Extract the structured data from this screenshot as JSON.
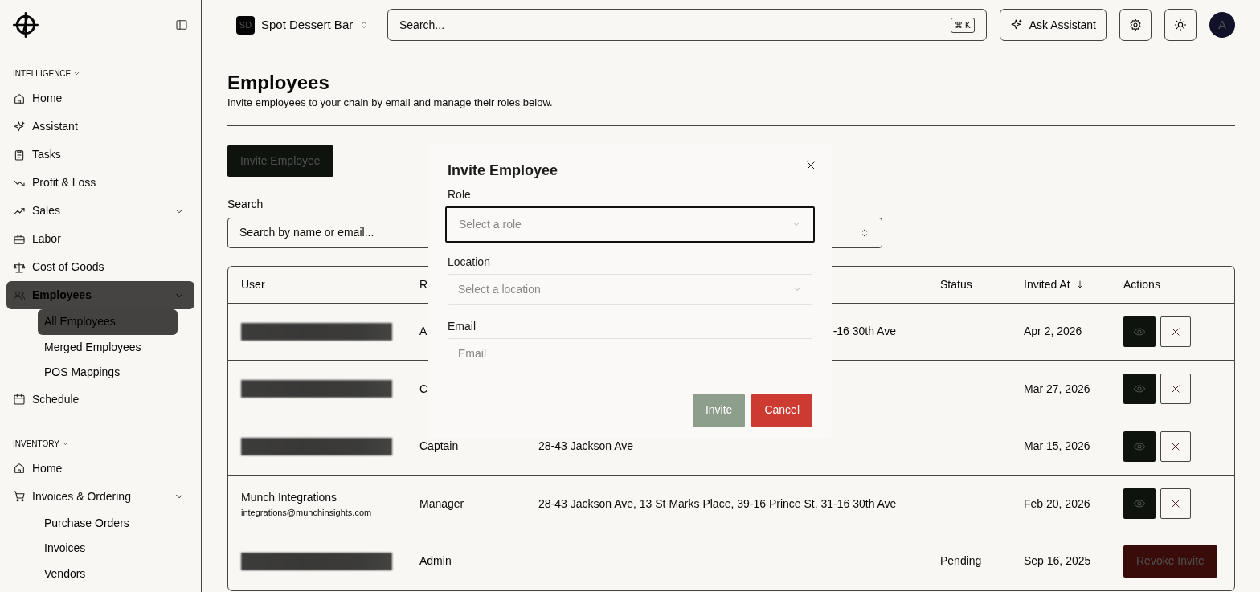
{
  "topbar": {
    "org_badge": "SD",
    "org_name": "Spot Dessert Bar",
    "search": {
      "placeholder": "Search...",
      "shortcut": "⌘ K"
    },
    "assistant_button": "Ask Assistant",
    "avatar": "A"
  },
  "sidebar": {
    "sections": [
      {
        "title": "INTELLIGENCE",
        "items": [
          {
            "label": "Home",
            "selected": false
          },
          {
            "label": "Assistant",
            "selected": false
          },
          {
            "label": "Tasks",
            "selected": false
          },
          {
            "label": "Profit & Loss",
            "selected": false
          },
          {
            "label": "Sales",
            "selected": false,
            "submenu": true
          },
          {
            "label": "Labor",
            "selected": false
          },
          {
            "label": "Cost of Goods",
            "selected": false
          },
          {
            "label": "Employees",
            "selected": true,
            "submenu": true,
            "expanded": true,
            "children": [
              {
                "label": "All Employees",
                "selected": true
              },
              {
                "label": "Merged Employees",
                "selected": false
              },
              {
                "label": "POS Mappings",
                "selected": false
              }
            ]
          },
          {
            "label": "Schedule",
            "selected": false
          }
        ]
      },
      {
        "title": "INVENTORY",
        "items": [
          {
            "label": "Home",
            "selected": false
          },
          {
            "label": "Invoices & Ordering",
            "selected": false,
            "submenu": true,
            "expanded": true,
            "children": [
              {
                "label": "Purchase Orders",
                "selected": false
              },
              {
                "label": "Invoices",
                "selected": false
              },
              {
                "label": "Vendors",
                "selected": false
              }
            ]
          }
        ]
      }
    ]
  },
  "page": {
    "title": "Employees",
    "subtitle": "Invite employees to your chain by email and manage their roles below.",
    "invite_button": "Invite Employee",
    "search_label": "Search",
    "search_placeholder": "Search by name or email..."
  },
  "table": {
    "columns": [
      {
        "label": "User"
      },
      {
        "label": "R"
      },
      {
        "label": "Status"
      },
      {
        "label": "Invited At",
        "sorted_desc": true
      },
      {
        "label": "Actions"
      }
    ],
    "rows": [
      {
        "user": {
          "kind": "redacted"
        },
        "role": "A",
        "location": {
          "text": "-16 30th Ave",
          "cut_start": true
        },
        "invited_at": "Apr 2, 2026",
        "actions": {
          "kind": "view_remove"
        }
      },
      {
        "user": {
          "kind": "redacted"
        },
        "role": "C",
        "invited_at": "Mar 27, 2026",
        "actions": {
          "kind": "view_remove"
        }
      },
      {
        "user": {
          "kind": "redacted"
        },
        "role": "Captain",
        "location": {
          "text": "28-43 Jackson Ave"
        },
        "invited_at": "Mar 15, 2026",
        "actions": {
          "kind": "view_remove"
        }
      },
      {
        "user": {
          "kind": "person",
          "name": "Munch Integrations",
          "email": "integrations@munchinsights.com"
        },
        "role": "Manager",
        "location": {
          "text": "28-43 Jackson Ave, 13 St Marks Place, 39-16 Prince St, 31-16 30th Ave"
        },
        "invited_at": "Feb 20, 2026",
        "actions": {
          "kind": "view_remove"
        }
      },
      {
        "user": {
          "kind": "redacted"
        },
        "role": "Admin",
        "status": "Pending",
        "invited_at": "Sep 16, 2025",
        "actions": {
          "kind": "revoke",
          "label": "Revoke Invite"
        }
      }
    ]
  },
  "modal": {
    "title": "Invite Employee",
    "fields": [
      {
        "kind": "select",
        "label": "Role",
        "placeholder": "Select a role",
        "focused": true
      },
      {
        "kind": "select",
        "label": "Location",
        "placeholder": "Select a location",
        "focused": false
      },
      {
        "kind": "input",
        "label": "Email",
        "placeholder": "Email",
        "focused": false
      }
    ],
    "buttons": [
      {
        "label": "Invite",
        "kind": "primary",
        "disabled": true
      },
      {
        "label": "Cancel",
        "kind": "danger",
        "disabled": false
      }
    ]
  }
}
